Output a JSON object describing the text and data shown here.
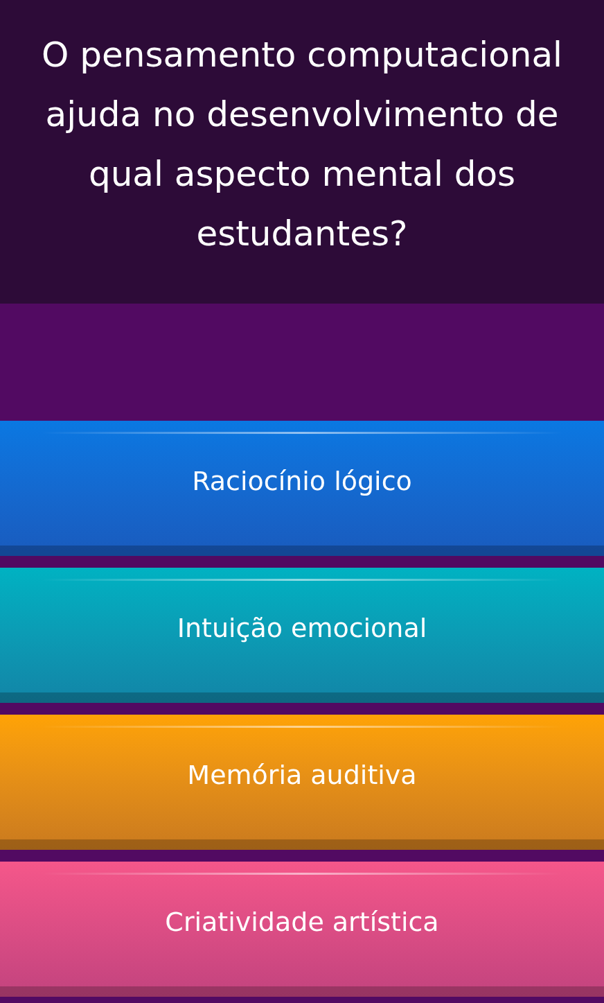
{
  "question": "O pensamento computacional ajuda no desenvolvimento de qual aspecto mental dos estudantes?",
  "options": [
    {
      "label": "Raciocínio lógico",
      "color": "#0a78e2"
    },
    {
      "label": "Intuição emocional",
      "color": "#00b2c2"
    },
    {
      "label": "Memória auditiva",
      "color": "#ffa305"
    },
    {
      "label": "Criatividade artística",
      "color": "#f5578a"
    }
  ]
}
